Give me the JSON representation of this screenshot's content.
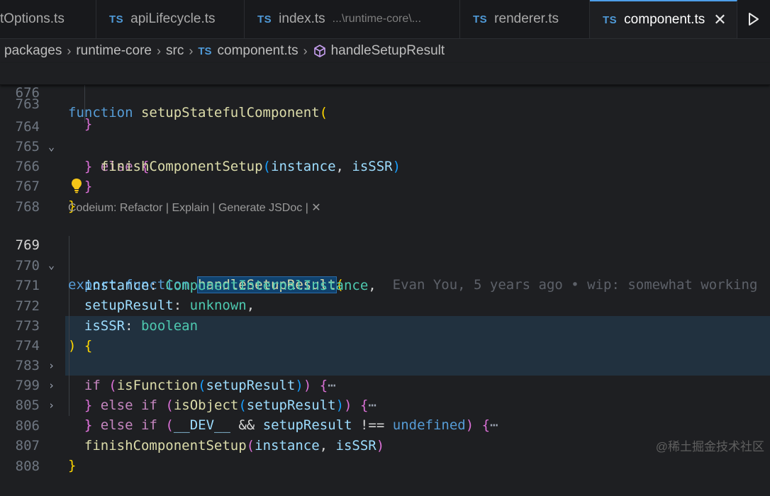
{
  "tabs": [
    {
      "label": "tOptions.ts",
      "active": false
    },
    {
      "lang": "TS",
      "label": "apiLifecycle.ts",
      "active": false
    },
    {
      "lang": "TS",
      "label": "index.ts",
      "desc": "...\\runtime-core\\...",
      "active": false
    },
    {
      "lang": "TS",
      "label": "renderer.ts",
      "active": false
    },
    {
      "lang": "TS",
      "label": "component.ts",
      "active": true,
      "close": "✕"
    }
  ],
  "breadcrumb": {
    "items": [
      "packages",
      "runtime-core",
      "src"
    ],
    "file_lang": "TS",
    "file": "component.ts",
    "symbol": "handleSetupResult"
  },
  "sticky": {
    "ln": "676"
  },
  "lines": {
    "l763": "763",
    "l764": "764",
    "l765": "765",
    "l766": "766",
    "l767": "767",
    "l768": "768",
    "l769": "769",
    "l770": "770",
    "l771": "771",
    "l772": "772",
    "l773": "773",
    "l774": "774",
    "l783": "783",
    "l799": "799",
    "l805": "805",
    "l806": "806",
    "l807": "807",
    "l808": "808"
  },
  "codelens": {
    "refactor": "Codeium: Refactor",
    "sep": " | ",
    "explain": "Explain",
    "jsdoc": "Generate JSDoc",
    "close": " | ✕"
  },
  "blame": "Evan You, 5 years ago • wip: somewhat working",
  "watermark": "@稀土掘金技术社区",
  "colors": {
    "tab_accent": "#4d9ee8",
    "ts_icon": "#4f9ad8",
    "folded_highlight": "#21313f"
  }
}
